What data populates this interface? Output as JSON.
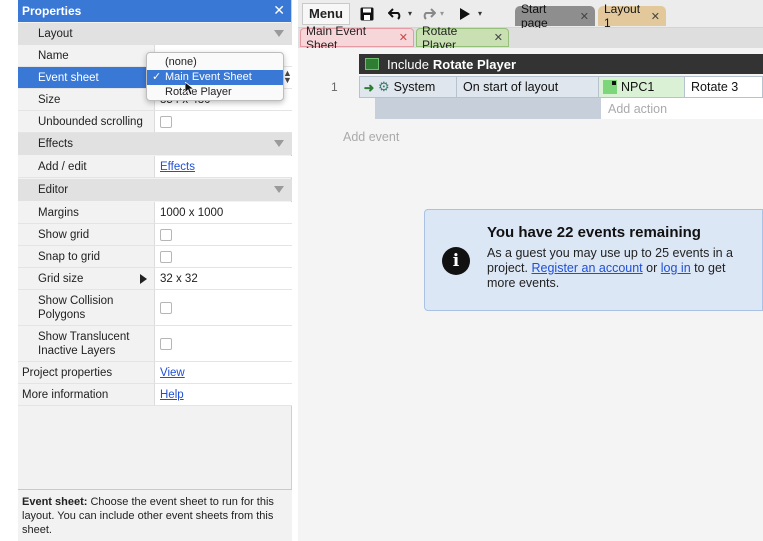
{
  "properties_panel": {
    "title": "Properties",
    "close_label": "✕",
    "categories": {
      "layout": "Layout",
      "effects": "Effects",
      "editor": "Editor"
    },
    "rows": {
      "name_label": "Name",
      "event_sheet_label": "Event sheet",
      "size_label": "Size",
      "size_value": "854 x 480",
      "unbounded_label": "Unbounded scrolling",
      "add_edit_label": "Add / edit",
      "effects_link": "Effects",
      "margins_label": "Margins",
      "margins_value": "1000 x 1000",
      "show_grid_label": "Show grid",
      "snap_grid_label": "Snap to grid",
      "grid_size_label": "Grid size",
      "grid_size_value": "32 x 32",
      "collision_label_1": "Show Collision",
      "collision_label_2": "Polygons",
      "translucent_label_1": "Show Translucent",
      "translucent_label_2": "Inactive Layers",
      "project_props_label": "Project properties",
      "project_props_link": "View",
      "more_info_label": "More information",
      "more_info_link": "Help"
    },
    "dropdown": {
      "options": [
        "(none)",
        "Main Event Sheet",
        "Rotate Player"
      ],
      "selected": "Main Event Sheet",
      "check": "✓"
    },
    "help": {
      "bold": "Event sheet:",
      "text": "Choose the event sheet to run for this layout. You can include other event sheets from this sheet."
    }
  },
  "toolbar": {
    "menu_label": "Menu",
    "save_icon": "save-icon",
    "undo_icon": "undo-icon",
    "redo_icon": "redo-icon",
    "play_icon": "play-icon",
    "layout_tabs": [
      {
        "label": "Start page",
        "color": "#8e8e8e"
      },
      {
        "label": "Layout 1",
        "color": "#e2c89a"
      }
    ]
  },
  "sheet_tabs": [
    {
      "label": "Main Event Sheet",
      "color": "#f7d6da"
    },
    {
      "label": "Rotate Player",
      "color": "#c9e0b3"
    }
  ],
  "event_sheet": {
    "include_prefix": "Include",
    "include_name": "Rotate Player",
    "event_number": "1",
    "object": "System",
    "condition": "On start of layout",
    "action_object": "NPC1",
    "action": "Rotate 3",
    "add_action": "Add action",
    "add_event": "Add event"
  },
  "notice": {
    "title": "You have 22 events remaining",
    "body_1": "As a guest you may use up to 25 events in a project.",
    "link_register": "Register an account",
    "body_2": "or",
    "link_login": "log in",
    "body_3": "to get more events."
  },
  "colors": {
    "accent": "#3a78d6",
    "link": "#1f4fd6",
    "notice_bg": "#dce7f6"
  }
}
